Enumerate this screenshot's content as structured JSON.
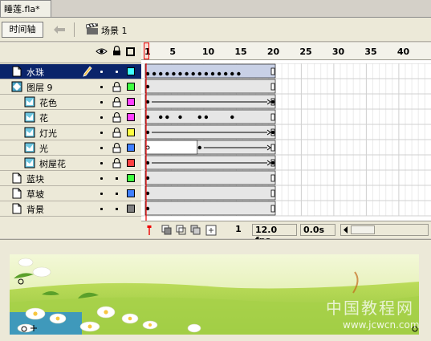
{
  "document": {
    "tab_title": "睡莲.fla*"
  },
  "toolbar": {
    "timeline_label": "时间轴",
    "scene_label": "场景 1"
  },
  "timeline": {
    "ruler_labels": [
      "1",
      "5",
      "10",
      "15",
      "20",
      "25",
      "30",
      "35",
      "40"
    ],
    "layers": [
      {
        "name": "水珠",
        "type": "layer",
        "selected": true,
        "color": "#40ffff"
      },
      {
        "name": "图层 9",
        "type": "mask",
        "selected": false,
        "color": "#40ff40"
      },
      {
        "name": "花色",
        "type": "masked",
        "selected": false,
        "color": "#ff40ff"
      },
      {
        "name": "花",
        "type": "masked",
        "selected": false,
        "color": "#ff40ff"
      },
      {
        "name": "灯光",
        "type": "masked",
        "selected": false,
        "color": "#ffff40"
      },
      {
        "name": "光",
        "type": "masked",
        "selected": false,
        "color": "#4080ff"
      },
      {
        "name": "树屋花",
        "type": "masked",
        "selected": false,
        "color": "#ff4040"
      },
      {
        "name": "蓝块",
        "type": "layer",
        "selected": false,
        "color": "#40ff40"
      },
      {
        "name": "草坡",
        "type": "layer",
        "selected": false,
        "color": "#4080ff"
      },
      {
        "name": "背景",
        "type": "layer",
        "selected": false,
        "color": "#808080"
      }
    ],
    "current_frame": "1",
    "frame_rate": "12.0 fps",
    "elapsed_time": "0.0s"
  },
  "stage": {
    "watermark_title": "中国教程网",
    "watermark_url": "www.jcwcn.com"
  },
  "icons": {
    "eye": "eye-icon",
    "lock": "lock-icon",
    "outline": "outline-icon",
    "pencil": "pencil-icon",
    "trash": "trash-icon",
    "clapper": "clapperboard-icon"
  }
}
